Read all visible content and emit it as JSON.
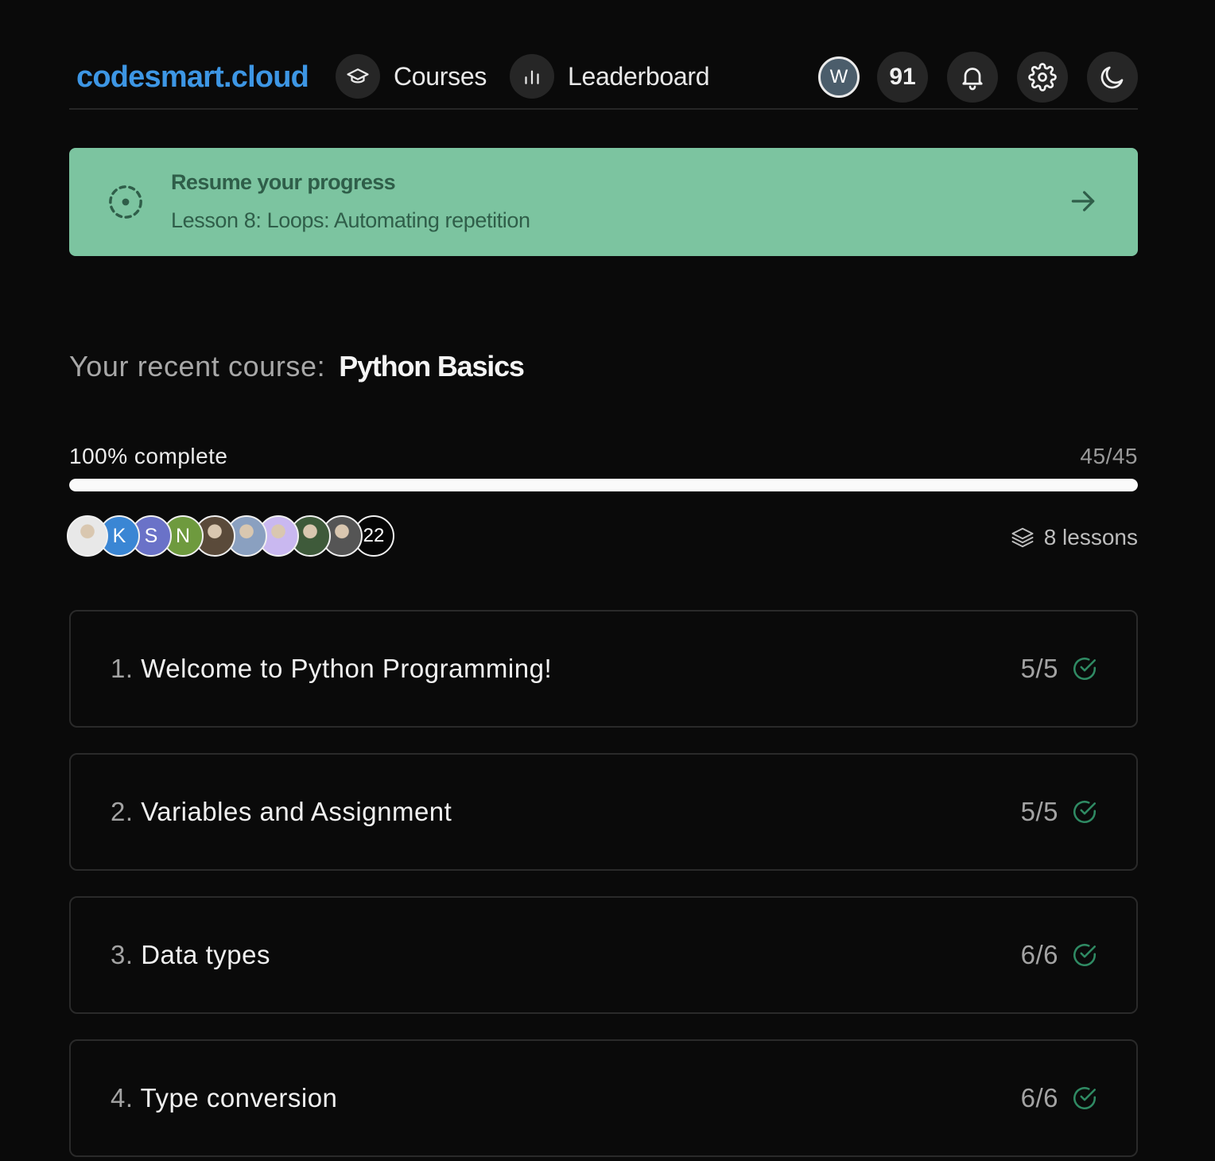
{
  "brand": "codesmart.cloud",
  "nav": [
    {
      "label": "Courses",
      "icon": "graduation-cap-icon"
    },
    {
      "label": "Leaderboard",
      "icon": "bar-chart-icon"
    }
  ],
  "header": {
    "user_initial": "W",
    "score": "91",
    "icons": [
      "bell-icon",
      "gear-icon",
      "moon-icon"
    ]
  },
  "resume": {
    "title": "Resume your progress",
    "lesson": "Lesson 8: Loops: Automating repetition"
  },
  "course": {
    "label": "Your recent course:",
    "name": "Python Basics",
    "progress_label": "100% complete",
    "progress_count": "45/45",
    "progress_fraction": 1.0,
    "lessons_count": "8 lessons"
  },
  "participants": {
    "avatars": [
      {
        "type": "image",
        "color": "#e8e8e8"
      },
      {
        "type": "initial",
        "initial": "K",
        "color": "#3a86d4"
      },
      {
        "type": "initial",
        "initial": "S",
        "color": "#6a72c8"
      },
      {
        "type": "initial",
        "initial": "N",
        "color": "#6e9a3e"
      },
      {
        "type": "image",
        "color": "#5a4a3a"
      },
      {
        "type": "image",
        "color": "#8aa0c0"
      },
      {
        "type": "image",
        "color": "#c9b8f0"
      },
      {
        "type": "image",
        "color": "#3e5a3a"
      },
      {
        "type": "image",
        "color": "#555555"
      }
    ],
    "more_count": "22"
  },
  "lessons": [
    {
      "num": "1.",
      "title": "Welcome to Python Programming!",
      "count": "5/5"
    },
    {
      "num": "2.",
      "title": "Variables and Assignment",
      "count": "5/5"
    },
    {
      "num": "3.",
      "title": "Data types",
      "count": "6/6"
    },
    {
      "num": "4.",
      "title": "Type conversion",
      "count": "6/6"
    }
  ],
  "colors": {
    "accent": "#3d96e4",
    "resume_bg": "#7cc4a0",
    "resume_text": "#2f5e49",
    "check": "#2f8a63"
  }
}
